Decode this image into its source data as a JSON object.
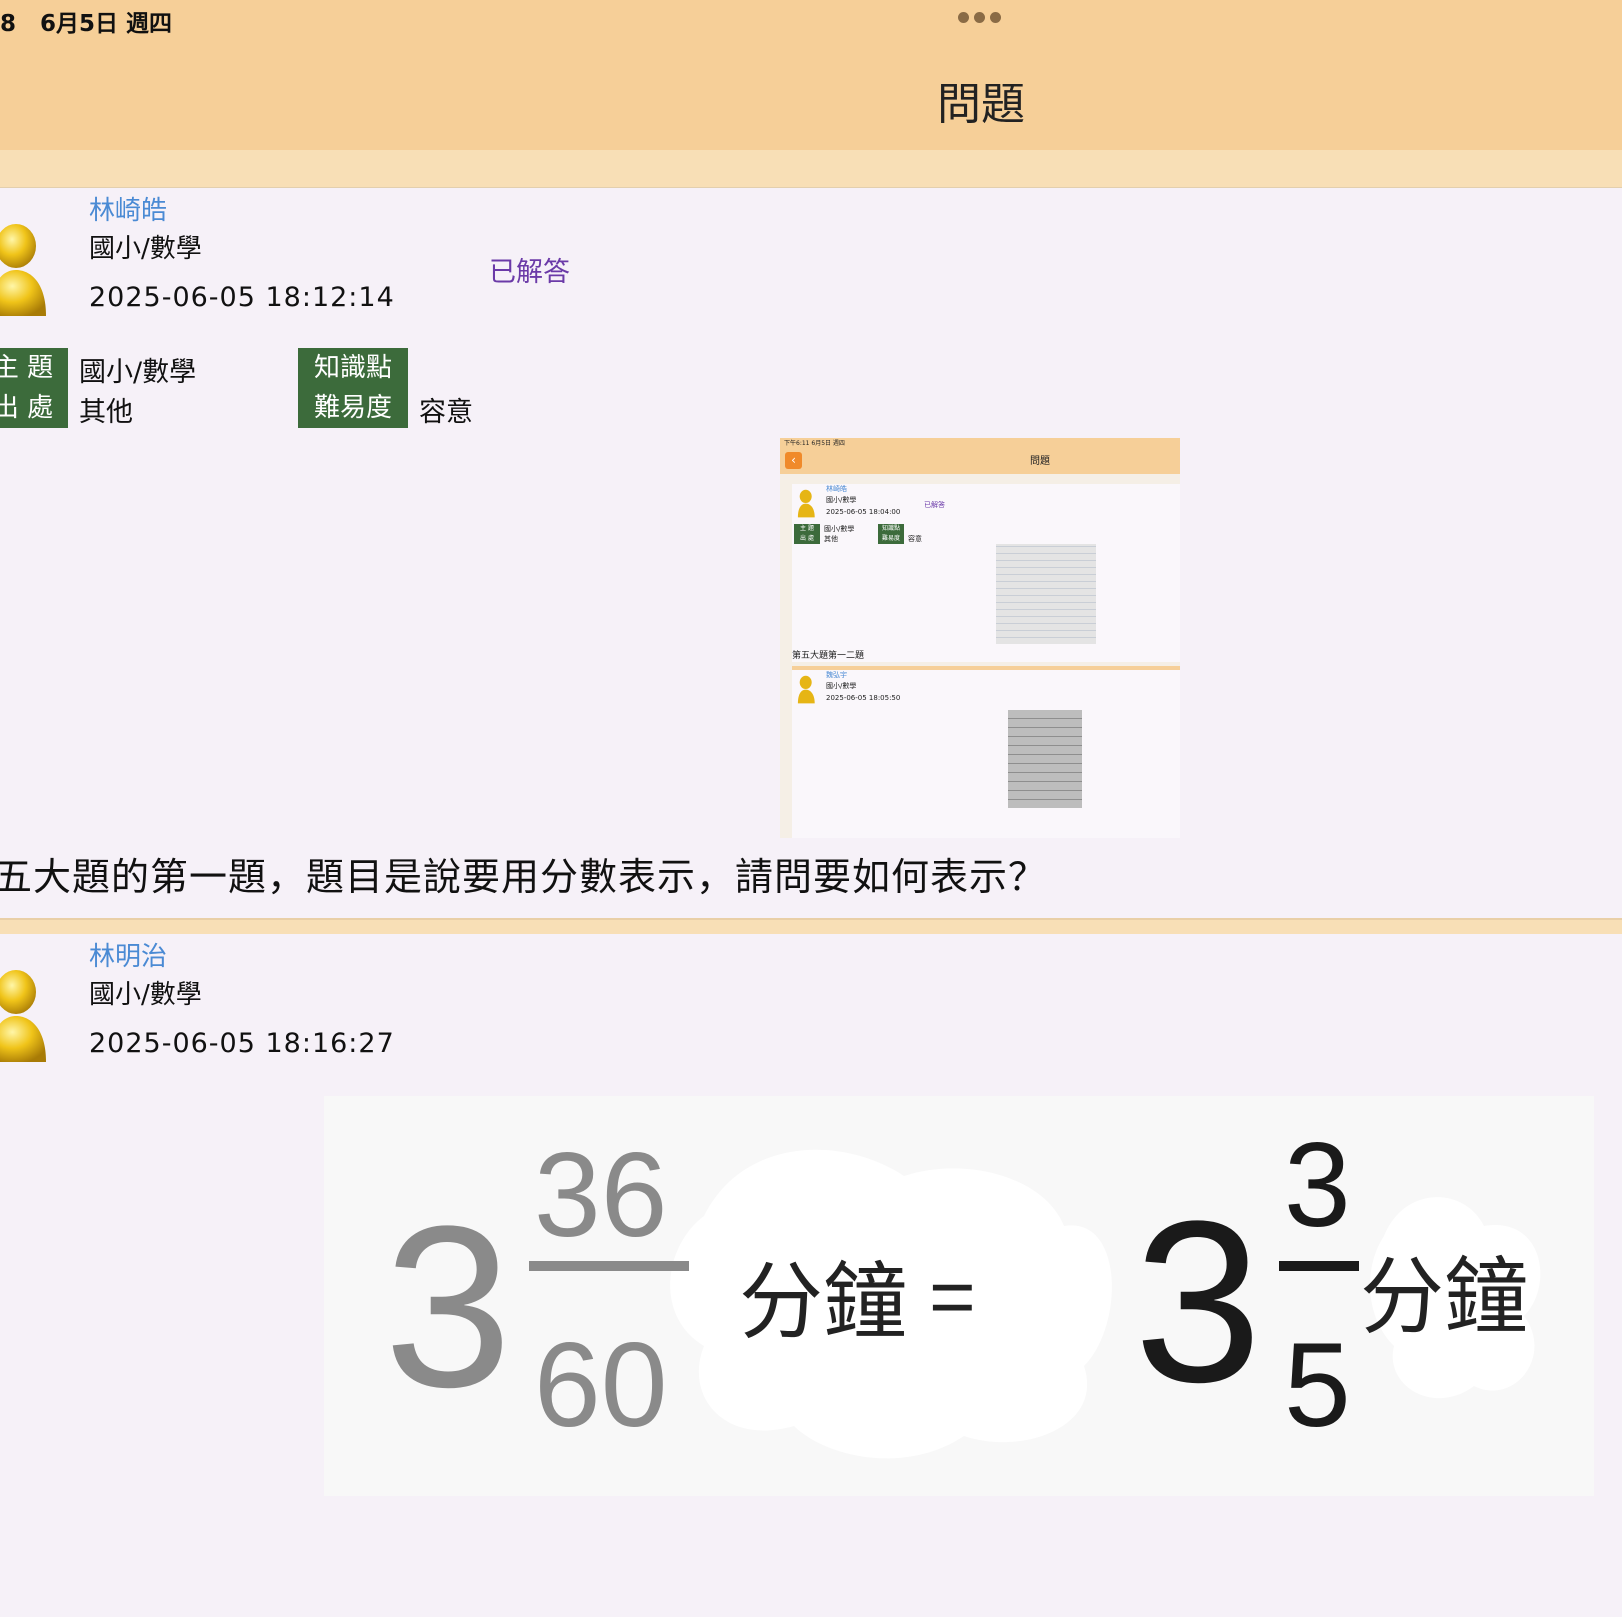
{
  "status": {
    "time_date": "8   6月5日 週四"
  },
  "nav": {
    "title": "問題"
  },
  "posts": [
    {
      "author": "林崎皓",
      "subject": "國小/數學",
      "time": "2025-06-05 18:12:14",
      "status": "已解答",
      "tags": {
        "topic_label": "主 題",
        "topic_value": "國小/數學",
        "source_label": "出 處",
        "source_value": "其他",
        "knowledge_label": "知識點",
        "difficulty_label": "難易度",
        "difficulty_value": "容意"
      },
      "question": "五大題的第一題，題目是說要用分數表示，請問要如何表示？",
      "thumbnail": {
        "status": "下午6:11   6月5日 週四",
        "title": "問題",
        "post1": {
          "author": "林崎皓",
          "subject": "國小/數學",
          "time": "2025-06-05 18:04:00",
          "status": "已解答",
          "tag_topic": "主 題",
          "tag_topic_value": "國小/數學",
          "tag_source": "出 處",
          "tag_source_value": "其他",
          "tag_knowledge": "知識點",
          "tag_difficulty": "難易度",
          "tag_difficulty_value": "容意",
          "caption": "第五大題第一二題"
        },
        "post2": {
          "author": "魏弘宇",
          "subject": "國小/數學",
          "time": "2025-06-05 18:05:50"
        }
      }
    },
    {
      "author": "林明治",
      "subject": "國小/數學",
      "time": "2025-06-05 18:16:27",
      "answer": {
        "left_whole": "3",
        "left_num": "36",
        "left_den": "60",
        "unit": "分鐘",
        "equals": "=",
        "right_whole": "3",
        "right_num": "3",
        "right_den": "5"
      }
    }
  ]
}
